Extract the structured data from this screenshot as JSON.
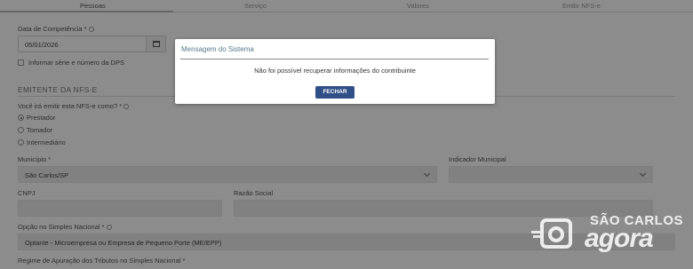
{
  "tabs": [
    "Pessoas",
    "Serviço",
    "Valores",
    "Emitir NFS-e"
  ],
  "form": {
    "data_competencia_label": "Data de Competência *",
    "data_competencia_value": "05/01/2026",
    "informar_serie_label": "Informar série e número da DPS",
    "emitente_section": "EMITENTE DA NFS-E",
    "emitir_como_label": "Você irá emitir esta NFS-e como? *",
    "radio_options": [
      "Prestador",
      "Tomador",
      "Intermediário"
    ],
    "radio_selected": "Prestador",
    "municipio_label": "Município *",
    "municipio_value": "São Carlos/SP",
    "indicador_label": "Indicador Municipal",
    "cnpj_label": "CNPJ",
    "razao_label": "Razão Social",
    "simples_label": "Opção no Simples Nacional *",
    "simples_value": "Optante - Microempresa ou Empresa de Pequeno Porte (ME/EPP)",
    "regime_label": "Regime de Apuração dos Tributos no Simples Nacional *"
  },
  "modal": {
    "title": "Mensagem do Sistema",
    "message": "Não foi possível recuperar informações do contribuinte",
    "button": "FECHAR"
  },
  "watermark": {
    "line1": "SÃO CARLOS",
    "line2": "agora"
  }
}
